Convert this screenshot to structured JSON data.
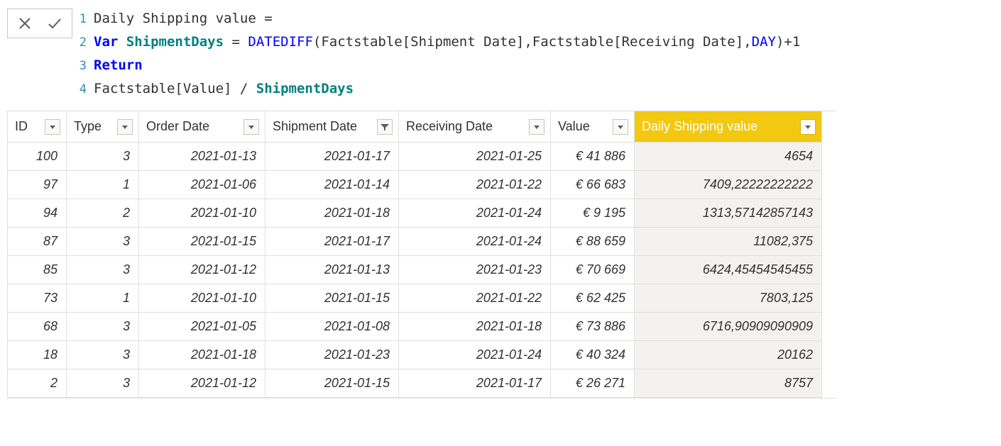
{
  "formula": {
    "line1_gutter": "1",
    "line1_text": "Daily Shipping value =",
    "line2_gutter": "2",
    "line2_kw": "Var",
    "line2_varname": "ShipmentDays",
    "line2_eq": " = ",
    "line2_fn": "DATEDIFF",
    "line2_args1": "(Factstable[Shipment Date],Factstable[Receiving Date],",
    "line2_enum": "DAY",
    "line2_args2": ")+1",
    "line3_gutter": "3",
    "line3_ret": "Return",
    "line4_gutter": "4",
    "line4_text1": "Factstable[Value] / ",
    "line4_var": "ShipmentDays"
  },
  "headers": {
    "id": "ID",
    "type": "Type",
    "order": "Order Date",
    "ship": "Shipment Date",
    "recv": "Receiving Date",
    "value": "Value",
    "daily": "Daily Shipping value"
  },
  "rows": [
    {
      "id": "100",
      "type": "3",
      "order": "2021-01-13",
      "ship": "2021-01-17",
      "recv": "2021-01-25",
      "value": "€ 41 886",
      "daily": "4654"
    },
    {
      "id": "97",
      "type": "1",
      "order": "2021-01-06",
      "ship": "2021-01-14",
      "recv": "2021-01-22",
      "value": "€ 66 683",
      "daily": "7409,22222222222"
    },
    {
      "id": "94",
      "type": "2",
      "order": "2021-01-10",
      "ship": "2021-01-18",
      "recv": "2021-01-24",
      "value": "€ 9 195",
      "daily": "1313,57142857143"
    },
    {
      "id": "87",
      "type": "3",
      "order": "2021-01-15",
      "ship": "2021-01-17",
      "recv": "2021-01-24",
      "value": "€ 88 659",
      "daily": "11082,375"
    },
    {
      "id": "85",
      "type": "3",
      "order": "2021-01-12",
      "ship": "2021-01-13",
      "recv": "2021-01-23",
      "value": "€ 70 669",
      "daily": "6424,45454545455"
    },
    {
      "id": "73",
      "type": "1",
      "order": "2021-01-10",
      "ship": "2021-01-15",
      "recv": "2021-01-22",
      "value": "€ 62 425",
      "daily": "7803,125"
    },
    {
      "id": "68",
      "type": "3",
      "order": "2021-01-05",
      "ship": "2021-01-08",
      "recv": "2021-01-18",
      "value": "€ 73 886",
      "daily": "6716,90909090909"
    },
    {
      "id": "18",
      "type": "3",
      "order": "2021-01-18",
      "ship": "2021-01-23",
      "recv": "2021-01-24",
      "value": "€ 40 324",
      "daily": "20162"
    },
    {
      "id": "2",
      "type": "3",
      "order": "2021-01-12",
      "ship": "2021-01-15",
      "recv": "2021-01-17",
      "value": "€ 26 271",
      "daily": "8757"
    }
  ]
}
